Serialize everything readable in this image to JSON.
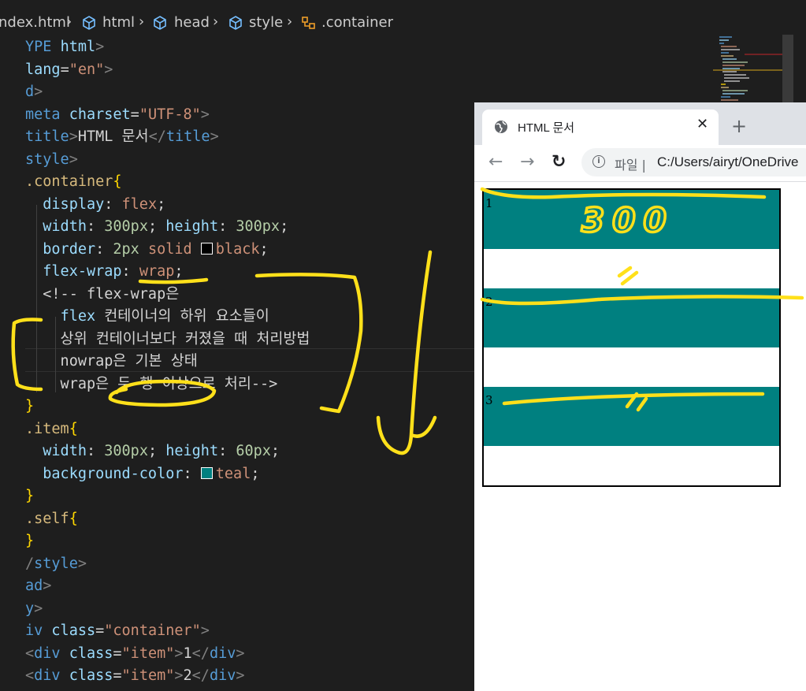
{
  "breadcrumb": {
    "file": "ndex.html",
    "items": [
      "html",
      "head",
      "style",
      ".container"
    ]
  },
  "code_lines": [
    [
      [
        "tag",
        "YPE "
      ],
      [
        "attr",
        "html"
      ],
      [
        "punct",
        ">"
      ]
    ],
    [
      [
        "attr",
        "lang"
      ],
      [
        "txt",
        "="
      ],
      [
        "str",
        "\"en\""
      ],
      [
        "punct",
        ">"
      ]
    ],
    [
      [
        "tag",
        "d"
      ],
      [
        "punct",
        ">"
      ]
    ],
    [
      [
        "tag",
        "meta "
      ],
      [
        "attr",
        "charset"
      ],
      [
        "txt",
        "="
      ],
      [
        "str",
        "\"UTF-8\""
      ],
      [
        "punct",
        ">"
      ]
    ],
    [
      [
        "tag",
        "title"
      ],
      [
        "punct",
        ">"
      ],
      [
        "txt",
        "HTML 문서"
      ],
      [
        "punct",
        "</"
      ],
      [
        "tag",
        "title"
      ],
      [
        "punct",
        ">"
      ]
    ],
    [
      [
        "tag",
        "style"
      ],
      [
        "punct",
        ">"
      ]
    ],
    [
      [
        "sel",
        ".container"
      ],
      [
        "brace",
        "{"
      ]
    ],
    [
      [
        "txt",
        "  "
      ],
      [
        "prop",
        "display"
      ],
      [
        "txt",
        ": "
      ],
      [
        "val",
        "flex"
      ],
      [
        "txt",
        ";"
      ]
    ],
    [
      [
        "txt",
        "  "
      ],
      [
        "prop",
        "width"
      ],
      [
        "txt",
        ": "
      ],
      [
        "num",
        "300px"
      ],
      [
        "txt",
        "; "
      ],
      [
        "prop",
        "height"
      ],
      [
        "txt",
        ": "
      ],
      [
        "num",
        "300px"
      ],
      [
        "txt",
        ";"
      ]
    ],
    [
      [
        "txt",
        "  "
      ],
      [
        "prop",
        "border"
      ],
      [
        "txt",
        ": "
      ],
      [
        "num",
        "2px"
      ],
      [
        "txt",
        " "
      ],
      [
        "val",
        "solid"
      ],
      [
        "txt",
        " "
      ],
      [
        "swatch",
        "#000000"
      ],
      [
        "val",
        "black"
      ],
      [
        "txt",
        ";"
      ]
    ],
    [
      [
        "txt",
        "  "
      ],
      [
        "prop",
        "flex-wrap"
      ],
      [
        "txt",
        ": "
      ],
      [
        "val",
        "wrap"
      ],
      [
        "txt",
        ";"
      ]
    ],
    [
      [
        "txt",
        "  "
      ],
      [
        "txt",
        "<!-- flex-wrap은"
      ]
    ],
    [
      [
        "txt",
        "    "
      ],
      [
        "prop",
        "flex"
      ],
      [
        "txt",
        " 컨테이너의 하위 요소들이"
      ]
    ],
    [
      [
        "txt",
        "    상위 컨테이너보다 커졌을 때 처리방법"
      ]
    ],
    [
      [
        "txt",
        "    nowrap은 기본 상태"
      ]
    ],
    [
      [
        "txt",
        "    wrap은 두 행 이상으로 처리-->"
      ]
    ],
    [
      [
        "brace",
        "}"
      ]
    ],
    [
      [
        "sel",
        ".item"
      ],
      [
        "brace",
        "{"
      ]
    ],
    [
      [
        "txt",
        "  "
      ],
      [
        "prop",
        "width"
      ],
      [
        "txt",
        ": "
      ],
      [
        "num",
        "300px"
      ],
      [
        "txt",
        "; "
      ],
      [
        "prop",
        "height"
      ],
      [
        "txt",
        ": "
      ],
      [
        "num",
        "60px"
      ],
      [
        "txt",
        ";"
      ]
    ],
    [
      [
        "txt",
        "  "
      ],
      [
        "prop",
        "background-color"
      ],
      [
        "txt",
        ": "
      ],
      [
        "swatch",
        "#008080"
      ],
      [
        "val",
        "teal"
      ],
      [
        "txt",
        ";"
      ]
    ],
    [
      [
        "brace",
        "}"
      ]
    ],
    [
      [
        "sel",
        ".self"
      ],
      [
        "brace",
        "{"
      ]
    ],
    [
      [
        "brace",
        "}"
      ]
    ],
    [
      [
        "punct",
        "/"
      ],
      [
        "tag",
        "style"
      ],
      [
        "punct",
        ">"
      ]
    ],
    [
      [
        "tag",
        "ad"
      ],
      [
        "punct",
        ">"
      ]
    ],
    [
      [
        "tag",
        "y"
      ],
      [
        "punct",
        ">"
      ]
    ],
    [
      [
        "tag",
        "iv "
      ],
      [
        "attr",
        "class"
      ],
      [
        "txt",
        "="
      ],
      [
        "str",
        "\"container\""
      ],
      [
        "punct",
        ">"
      ]
    ],
    [
      [
        "punct",
        "<"
      ],
      [
        "tag",
        "div "
      ],
      [
        "attr",
        "class"
      ],
      [
        "txt",
        "="
      ],
      [
        "str",
        "\"item\""
      ],
      [
        "punct",
        ">"
      ],
      [
        "txt",
        "1"
      ],
      [
        "punct",
        "</"
      ],
      [
        "tag",
        "div"
      ],
      [
        "punct",
        ">"
      ]
    ],
    [
      [
        "punct",
        "<"
      ],
      [
        "tag",
        "div "
      ],
      [
        "attr",
        "class"
      ],
      [
        "txt",
        "="
      ],
      [
        "str",
        "\"item\""
      ],
      [
        "punct",
        ">"
      ],
      [
        "txt",
        "2"
      ],
      [
        "punct",
        "</"
      ],
      [
        "tag",
        "div"
      ],
      [
        "punct",
        ">"
      ]
    ]
  ],
  "browser": {
    "tab_title": "HTML 문서",
    "tab_close": "✕",
    "new_tab": "+",
    "back": "←",
    "forward": "→",
    "reload": "↻",
    "info": "i",
    "address_label": "파일  |",
    "url": "C:/Users/airyt/OneDrive",
    "items": [
      "1",
      "2",
      "3"
    ],
    "item_color": "#008080"
  },
  "annotations": {
    "width_note": "300",
    "equals_mark": "//",
    "color": "#ffe01a"
  }
}
